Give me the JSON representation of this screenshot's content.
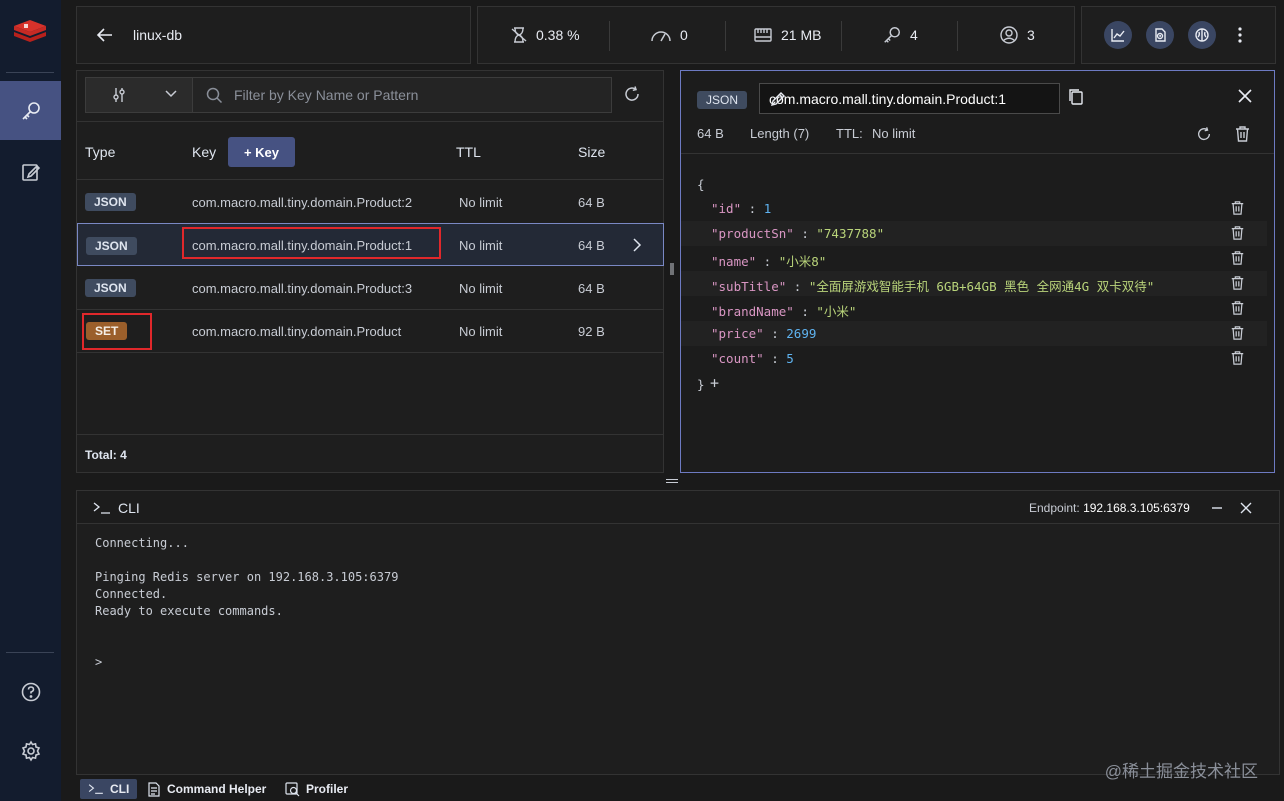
{
  "header": {
    "db_name": "linux-db",
    "stats": {
      "cpu": "0.38 %",
      "ops": "0",
      "memory": "21 MB",
      "keys": "4",
      "clients": "3"
    }
  },
  "filter": {
    "placeholder": "Filter by Key Name or Pattern"
  },
  "key_list": {
    "columns": {
      "type": "Type",
      "key": "Key",
      "ttl": "TTL",
      "size": "Size"
    },
    "add_key": "+ Key",
    "rows": [
      {
        "type": "JSON",
        "key": "com.macro.mall.tiny.domain.Product:2",
        "ttl": "No limit",
        "size": "64 B"
      },
      {
        "type": "JSON",
        "key": "com.macro.mall.tiny.domain.Product:1",
        "ttl": "No limit",
        "size": "64 B"
      },
      {
        "type": "JSON",
        "key": "com.macro.mall.tiny.domain.Product:3",
        "ttl": "No limit",
        "size": "64 B"
      },
      {
        "type": "SET",
        "key": "com.macro.mall.tiny.domain.Product",
        "ttl": "No limit",
        "size": "92 B"
      }
    ],
    "total": "Total: 4"
  },
  "details": {
    "type": "JSON",
    "key_name": "com.macro.mall.tiny.domain.Product:1",
    "size": "64 B",
    "length": "Length (7)",
    "ttl_label": "TTL:",
    "ttl_value": "No limit",
    "open_brace": "{",
    "close_brace": "}",
    "add": "+",
    "fields": [
      {
        "key": "\"id\"",
        "value": "1",
        "kind": "num"
      },
      {
        "key": "\"productSn\"",
        "value": "\"7437788\"",
        "kind": "str"
      },
      {
        "key": "\"name\"",
        "value": "\"小米8\"",
        "kind": "str"
      },
      {
        "key": "\"subTitle\"",
        "value": "\"全面屏游戏智能手机 6GB+64GB 黑色 全网通4G 双卡双待\"",
        "kind": "str"
      },
      {
        "key": "\"brandName\"",
        "value": "\"小米\"",
        "kind": "str"
      },
      {
        "key": "\"price\"",
        "value": "2699",
        "kind": "num"
      },
      {
        "key": "\"count\"",
        "value": "5",
        "kind": "num"
      }
    ]
  },
  "cli": {
    "title": "CLI",
    "endpoint_label": "Endpoint:",
    "endpoint_value": "192.168.3.105:6379",
    "lines": [
      "Connecting...",
      "",
      "Pinging Redis server on 192.168.3.105:6379",
      "Connected.",
      "Ready to execute commands."
    ],
    "prompt": ">"
  },
  "bottom_bar": {
    "cli": "CLI",
    "command_helper": "Command Helper",
    "profiler": "Profiler"
  },
  "watermark": "@稀土掘金技术社区",
  "colors": {
    "accent": "#465282",
    "json_badge": "#3f4b5f",
    "set_badge": "#9b5f2b",
    "highlight_box": "#e0282b"
  }
}
